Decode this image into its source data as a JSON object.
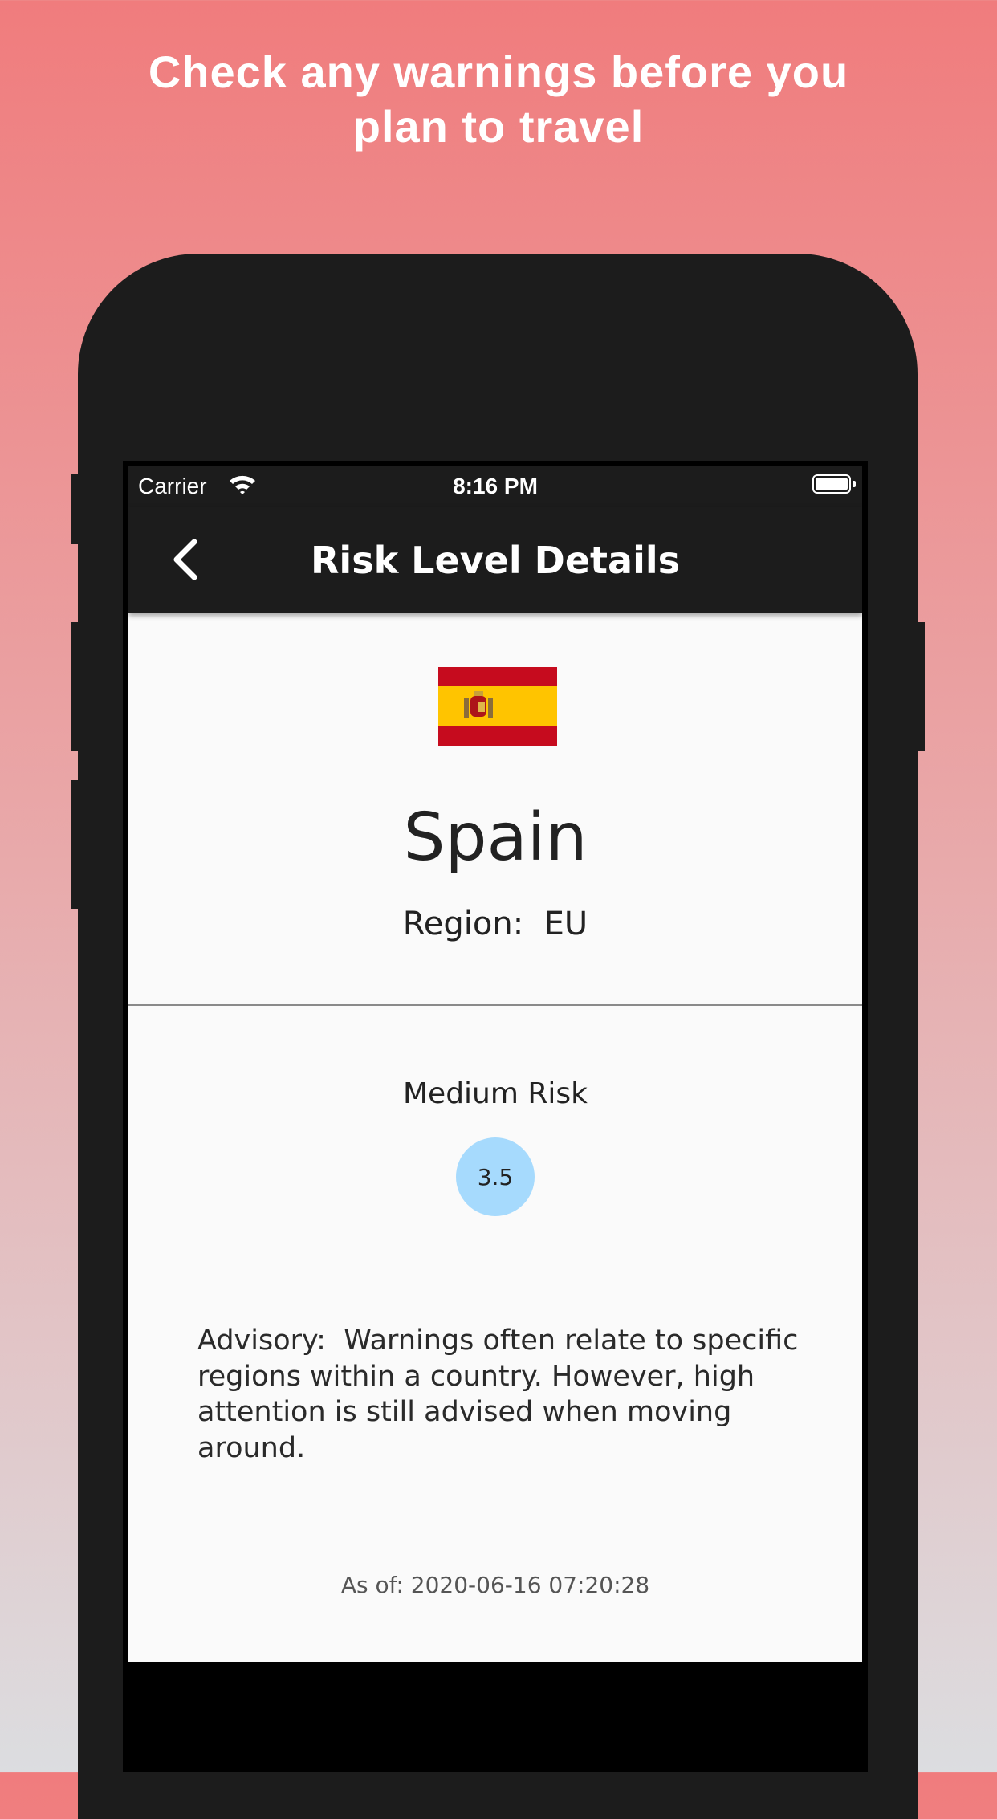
{
  "promo": {
    "headline_line1": "Check any warnings before you",
    "headline_line2": "plan to travel"
  },
  "status_bar": {
    "carrier": "Carrier",
    "time": "8:16 PM",
    "wifi_icon": "wifi-icon",
    "battery_icon": "battery-icon"
  },
  "nav": {
    "back_icon": "chevron-left-icon",
    "title": "Risk Level Details"
  },
  "country": {
    "name": "Spain",
    "flag_icon": "spain-flag-icon",
    "region": "Region:  EU"
  },
  "risk": {
    "label": "Medium Risk",
    "score": "3.5",
    "score_color": "#a6dafd"
  },
  "advisory": "Advisory:  Warnings often relate to specific regions within a country. However, high attention is still advised when moving around.",
  "as_of": "As of: 2020-06-16 07:20:28",
  "colors": {
    "nav_bg": "#1c1c1c",
    "content_bg": "#fafafa",
    "flag_red": "#c60b1e",
    "flag_yellow": "#ffc400"
  }
}
